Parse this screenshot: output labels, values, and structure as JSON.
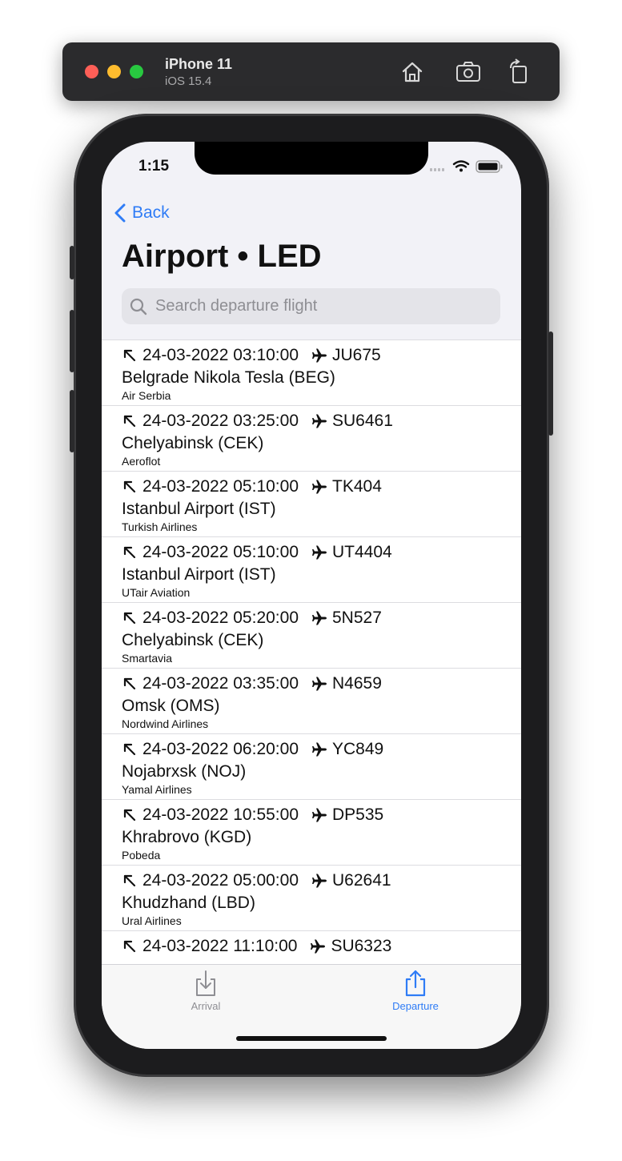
{
  "simulator": {
    "device_name": "iPhone 11",
    "os_version": "iOS 15.4"
  },
  "status_bar": {
    "time": "1:15"
  },
  "nav": {
    "back_label": "Back",
    "title": "Airport • LED"
  },
  "search": {
    "placeholder": "Search departure flight",
    "value": ""
  },
  "flights": [
    {
      "datetime": "24-03-2022 03:10:00",
      "flight": "JU675",
      "destination": "Belgrade Nikola Tesla (BEG)",
      "airline": "Air Serbia"
    },
    {
      "datetime": "24-03-2022 03:25:00",
      "flight": "SU6461",
      "destination": "Chelyabinsk (CEK)",
      "airline": "Aeroflot"
    },
    {
      "datetime": "24-03-2022 05:10:00",
      "flight": "TK404",
      "destination": "Istanbul Airport (IST)",
      "airline": "Turkish Airlines"
    },
    {
      "datetime": "24-03-2022 05:10:00",
      "flight": "UT4404",
      "destination": "Istanbul Airport (IST)",
      "airline": "UTair Aviation"
    },
    {
      "datetime": "24-03-2022 05:20:00",
      "flight": "5N527",
      "destination": "Chelyabinsk (CEK)",
      "airline": "Smartavia"
    },
    {
      "datetime": "24-03-2022 03:35:00",
      "flight": "N4659",
      "destination": "Omsk (OMS)",
      "airline": "Nordwind Airlines"
    },
    {
      "datetime": "24-03-2022 06:20:00",
      "flight": "YC849",
      "destination": "Nojabrxsk (NOJ)",
      "airline": "Yamal Airlines"
    },
    {
      "datetime": "24-03-2022 10:55:00",
      "flight": "DP535",
      "destination": "Khrabrovo (KGD)",
      "airline": "Pobeda"
    },
    {
      "datetime": "24-03-2022 05:00:00",
      "flight": "U62641",
      "destination": "Khudzhand (LBD)",
      "airline": "Ural Airlines"
    },
    {
      "datetime": "24-03-2022 11:10:00",
      "flight": "SU6323",
      "destination": "",
      "airline": ""
    }
  ],
  "tabs": {
    "arrival_label": "Arrival",
    "departure_label": "Departure",
    "selected": "Departure"
  },
  "colors": {
    "accent": "#2f7cf6",
    "inactive": "#8e8e93"
  },
  "icons": {
    "departure_arrow": "arrow-up-left-icon",
    "plane": "airplane-icon",
    "search": "magnifying-glass-icon",
    "back": "chevron-left-icon",
    "arrival_tab": "tray-arrow-down-icon",
    "departure_tab": "share-arrow-up-icon"
  }
}
